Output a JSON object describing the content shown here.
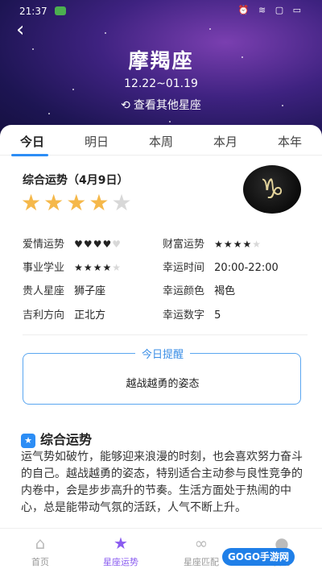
{
  "status_bar": {
    "time": "21:37",
    "icons": "⏰ ≋ ▢ ▭"
  },
  "header": {
    "back_icon": "chevron-left-icon",
    "sign_name": "摩羯座",
    "date_range": "12.22~01.19",
    "switch_label": "查看其他星座"
  },
  "tabs": [
    "今日",
    "明日",
    "本周",
    "本月",
    "本年"
  ],
  "active_tab": "今日",
  "overall": {
    "title": "综合运势（4月9日）",
    "stars": 4,
    "max_stars": 5,
    "sign_symbol": "♑"
  },
  "fortunes": {
    "love_label": "爱情运势",
    "love_level": 4,
    "wealth_label": "财富运势",
    "wealth_level": 4,
    "career_label": "事业学业",
    "career_level": 4,
    "lucky_time_label": "幸运时间",
    "lucky_time": "20:00-22:00",
    "noble_label": "贵人星座",
    "noble": "狮子座",
    "lucky_color_label": "幸运颜色",
    "lucky_color": "褐色",
    "direction_label": "吉利方向",
    "direction": "正北方",
    "lucky_number_label": "幸运数字",
    "lucky_number": "5"
  },
  "reminder": {
    "label": "今日提醒",
    "text": "越战越勇的姿态"
  },
  "section": {
    "title": "综合运势",
    "text": "运气势如破竹，能够迎来浪漫的时刻，也会喜欢努力奋斗的自己。越战越勇的姿态，特别适合主动参与良性竞争的内卷中，会是步步高升的节奏。生活方面处于热闹的中心，总是能带动气氛的活跃，人气不断上升。"
  },
  "bottom_nav": [
    {
      "label": "首页",
      "icon": "home-icon"
    },
    {
      "label": "星座运势",
      "icon": "star-icon"
    },
    {
      "label": "星座匹配",
      "icon": "link-icon"
    },
    {
      "label": "我的",
      "icon": "user-icon"
    }
  ],
  "watermark": "GOGO手游网",
  "colors": {
    "accent": "#2c8df5",
    "star": "#f5b84a",
    "heart": "#ff6fa0",
    "nav_active": "#8a5cf0"
  }
}
